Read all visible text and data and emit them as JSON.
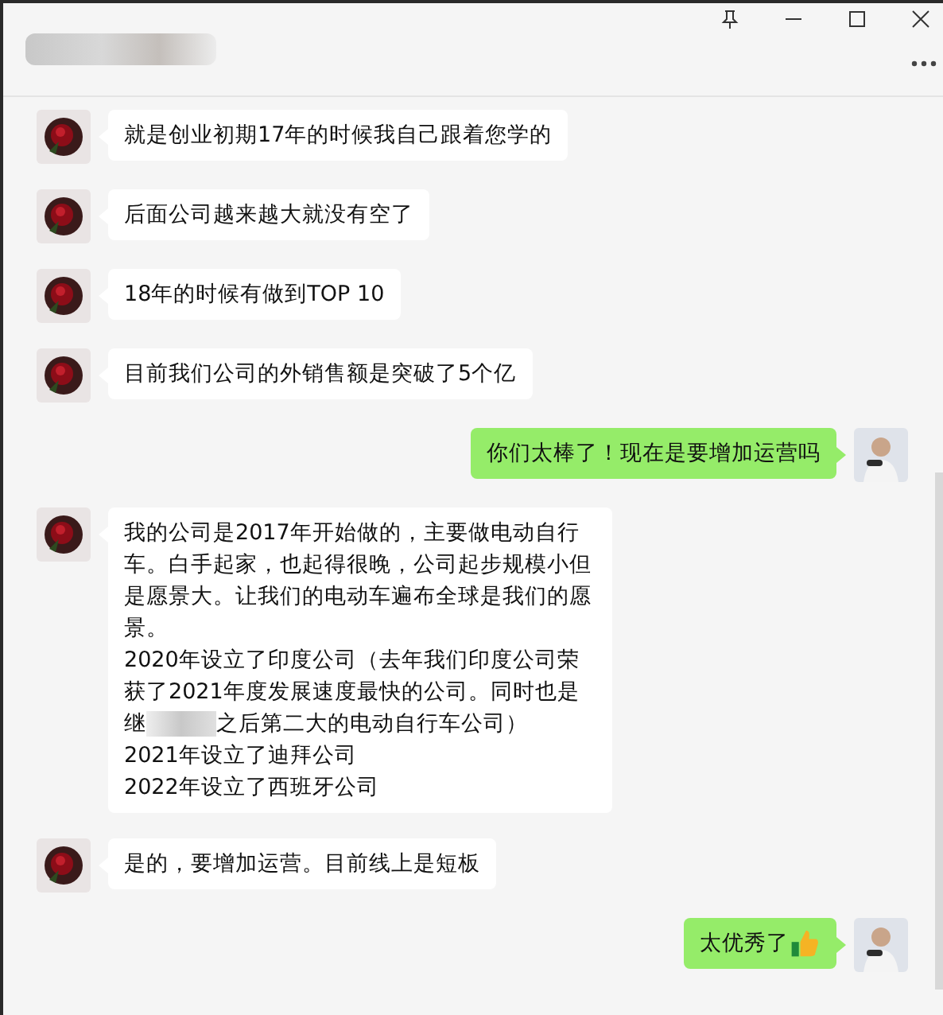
{
  "messages": [
    {
      "kind": "received",
      "parts": [
        {
          "kind": "text",
          "text": "就是创业初期17年的时候我自己跟着您学的"
        }
      ]
    },
    {
      "kind": "received",
      "parts": [
        {
          "kind": "text",
          "text": "后面公司越来越大就没有空了"
        }
      ]
    },
    {
      "kind": "received",
      "parts": [
        {
          "kind": "text",
          "text": "18年的时候有做到TOP 10"
        }
      ]
    },
    {
      "kind": "received",
      "parts": [
        {
          "kind": "text",
          "text": "目前我们公司的外销售额是突破了5个亿"
        }
      ]
    },
    {
      "kind": "sent",
      "parts": [
        {
          "kind": "text",
          "text": "你们太棒了！现在是要增加运营吗"
        }
      ]
    },
    {
      "kind": "received",
      "parts": [
        {
          "kind": "text",
          "text": "我的公司是2017年开始做的，主要做电动自行车。白手起家，也起得很晚，公司起步规模小但是愿景大。让我们的电动车遍布全球是我们的愿景。\n2020年设立了印度公司（去年我们印度公司荣获了2021年度发展速度最快的公司。同时也是继"
        },
        {
          "kind": "redacted"
        },
        {
          "kind": "text",
          "text": "之后第二大的电动自行车公司）\n2021年设立了迪拜公司\n2022年设立了西班牙公司"
        }
      ]
    },
    {
      "kind": "received",
      "parts": [
        {
          "kind": "text",
          "text": "是的，要增加运营。目前线上是短板"
        }
      ]
    },
    {
      "kind": "sent",
      "parts": [
        {
          "kind": "text",
          "text": "太优秀了"
        },
        {
          "kind": "thumbs"
        }
      ]
    }
  ]
}
